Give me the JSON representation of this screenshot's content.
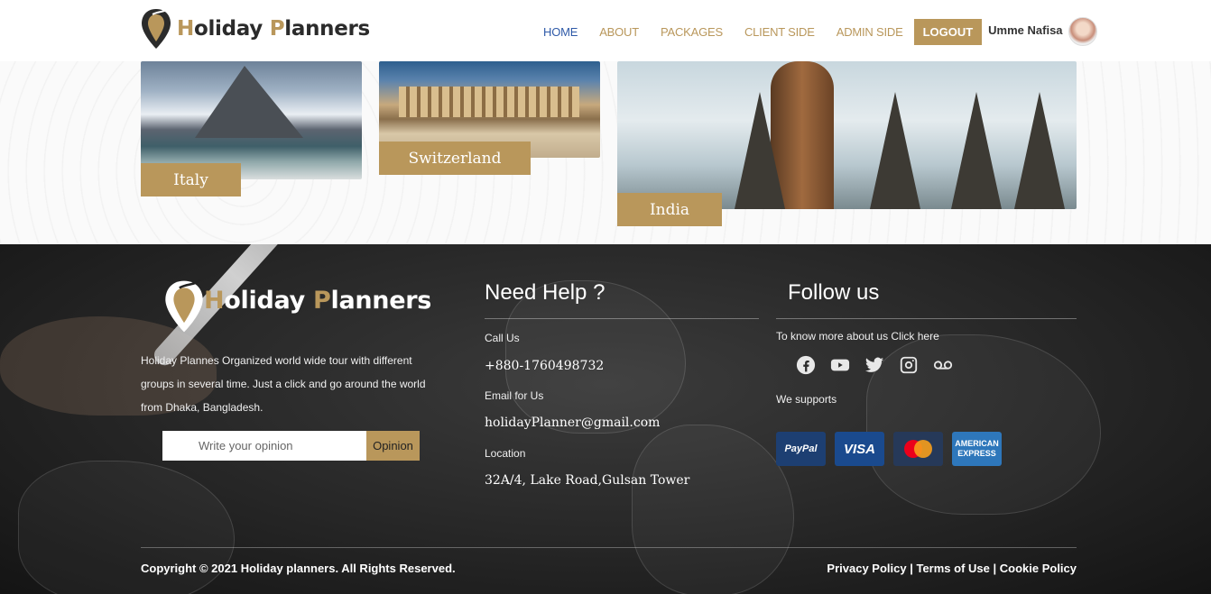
{
  "brand": {
    "first_h": "H",
    "part1": "oliday ",
    "first_p": "P",
    "part2": "lanners"
  },
  "nav": {
    "items": [
      {
        "label": "HOME",
        "active": true
      },
      {
        "label": "ABOUT"
      },
      {
        "label": "PACKAGES"
      },
      {
        "label": "CLIENT SIDE"
      },
      {
        "label": "ADMIN SIDE"
      }
    ],
    "logout_label": "LOGOUT",
    "user_name": "Umme Nafisa"
  },
  "destinations": [
    {
      "label": "Italy"
    },
    {
      "label": "Switzerland"
    },
    {
      "label": "India"
    }
  ],
  "footer": {
    "about": "Holiday Plannes Organized world wide tour with different groups in several time. Just a click and go around the world from Dhaka, Bangladesh.",
    "opinion_placeholder": "Write your opinion",
    "opinion_button": "Opinion",
    "help": {
      "title": "Need Help ?",
      "call_label": "Call Us",
      "phone": "+880-1760498732",
      "email_label": "Email for Us",
      "email": "holidayPlanner@gmail.com",
      "location_label": "Location",
      "address": "32A/4, Lake Road,Gulsan Tower"
    },
    "follow": {
      "title": "Follow us",
      "know_more": "To know more about us Click here",
      "supports_label": "We supports",
      "payment": {
        "paypal": "PayPal",
        "visa": "VISA",
        "amex_line1": "AMERICAN",
        "amex_line2": "EXPRESS"
      }
    },
    "copyright": "Copyright © 2021 Holiday planners. All Rights Reserved.",
    "privacy": "Privacy Policy",
    "sep": " | ",
    "terms": "Terms of Use",
    "cookie": "Cookie Policy"
  },
  "colors": {
    "gold": "#b9975b",
    "active_nav": "#2f5aa8",
    "footer_bg": "#262626"
  }
}
